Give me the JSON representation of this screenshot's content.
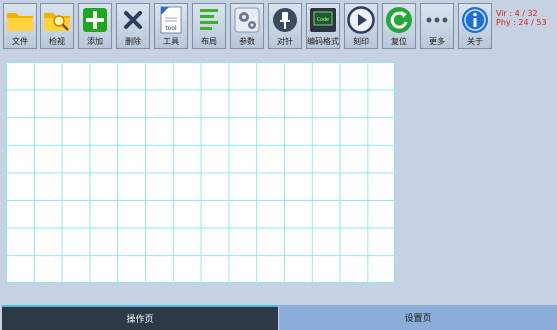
{
  "toolbar": {
    "buttons": [
      {
        "label": "文件",
        "icon": "folder-icon"
      },
      {
        "label": "检视",
        "icon": "folder-search-icon"
      },
      {
        "label": "添加",
        "icon": "add-icon"
      },
      {
        "label": "删除",
        "icon": "delete-icon"
      },
      {
        "label": "工具",
        "icon": "tool-icon"
      },
      {
        "label": "布局",
        "icon": "layout-icon"
      },
      {
        "label": "参数",
        "icon": "gears-icon"
      },
      {
        "label": "对针",
        "icon": "pin-icon"
      },
      {
        "label": "编码格式",
        "icon": "encoding-icon"
      },
      {
        "label": "刻印",
        "icon": "play-icon"
      },
      {
        "label": "复位",
        "icon": "reset-icon"
      },
      {
        "label": "更多",
        "icon": "more-icon"
      },
      {
        "label": "关于",
        "icon": "info-icon"
      }
    ]
  },
  "counters": {
    "vir": "Vir : 4 / 32",
    "phy": "Phy : 24 / 53"
  },
  "tabs": {
    "operation": "操作页",
    "settings": "设置页"
  },
  "colors": {
    "background": "#c6d2e1",
    "grid_line": "#8fe8ec",
    "counter_text": "#d41e1e",
    "active_tab": "#2c3947",
    "inactive_tab": "#8aaed9"
  }
}
